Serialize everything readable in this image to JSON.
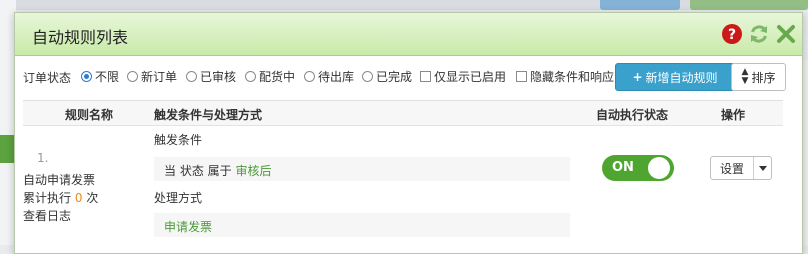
{
  "dialog": {
    "title": "自动规则列表",
    "icons": {
      "help": "help-icon",
      "refresh": "refresh-icon",
      "close": "close-icon"
    },
    "colors": {
      "header_bg": "#c9eaa9",
      "accent_green": "#4ea52f",
      "primary_blue": "#3aa0cc",
      "help_red": "#cc1818",
      "count_orange": "#e88b1d"
    }
  },
  "filter": {
    "label": "订单状态",
    "options": [
      {
        "label": "不限",
        "selected": true
      },
      {
        "label": "新订单",
        "selected": false
      },
      {
        "label": "已审核",
        "selected": false
      },
      {
        "label": "配货中",
        "selected": false
      },
      {
        "label": "待出库",
        "selected": false
      },
      {
        "label": "已完成",
        "selected": false
      }
    ],
    "checkboxes": [
      {
        "label": "仅显示已启用",
        "checked": false
      },
      {
        "label": "隐藏条件和响应",
        "checked": false
      }
    ]
  },
  "toolbar": {
    "add_label": "新增自动规则",
    "add_icon": "plus-icon",
    "sort_label": "排序",
    "sort_icon": "sort-icon"
  },
  "table": {
    "headers": [
      "规则名称",
      "触发条件与处理方式",
      "自动执行状态",
      "操作"
    ],
    "rows": [
      {
        "index": "1.",
        "name": "自动申请发票",
        "exec_prefix": "累计执行",
        "exec_count": "0",
        "exec_suffix": "次",
        "log_link": "查看日志",
        "trigger_title": "触发条件",
        "trigger_prefix": "当 状态 属于",
        "trigger_value": "审核后",
        "action_title": "处理方式",
        "action_value": "申请发票",
        "status_label": "ON",
        "status_on": true,
        "setting_label": "设置"
      }
    ]
  }
}
